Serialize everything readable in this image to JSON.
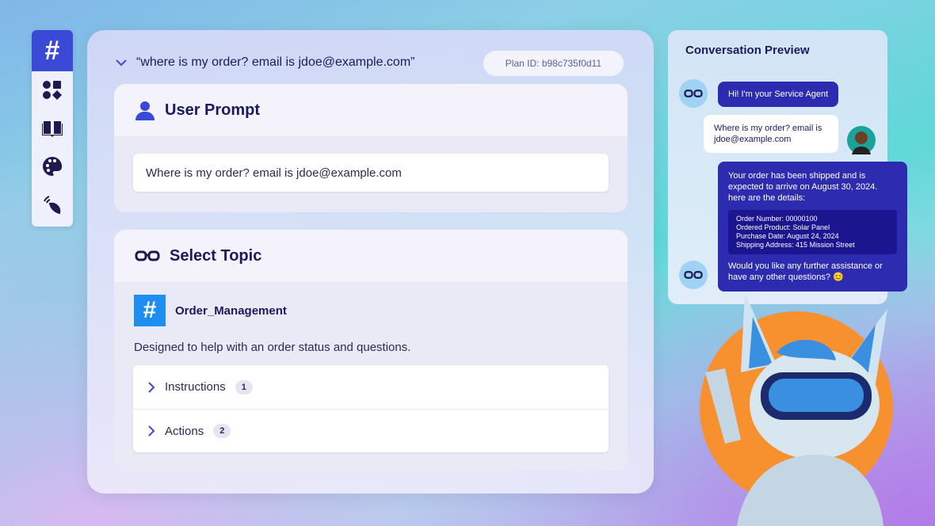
{
  "sidebar": {
    "items": [
      {
        "icon": "hash-icon",
        "active": true,
        "label": "#"
      },
      {
        "icon": "shapes-icon"
      },
      {
        "icon": "book-icon"
      },
      {
        "icon": "palette-icon"
      },
      {
        "icon": "signal-icon"
      }
    ]
  },
  "main": {
    "query": "“where is my order? email is jdoe@example.com”",
    "plan_id": "Plan ID: b98c735f0d11",
    "user_prompt": {
      "title": "User Prompt",
      "value": "Where is my order? email is jdoe@example.com"
    },
    "select_topic": {
      "title": "Select Topic",
      "hash": "#",
      "topic_name": "Order_Management",
      "description": "Designed to help with an order status and questions.",
      "sections": [
        {
          "label": "Instructions",
          "count": "1"
        },
        {
          "label": "Actions",
          "count": "2"
        }
      ]
    }
  },
  "conversation": {
    "title": "Conversation Preview",
    "messages": [
      {
        "role": "agent",
        "text": "Hi! I'm your Service Agent"
      },
      {
        "role": "user",
        "text": "Where is my order? email is jdoe@example.com"
      },
      {
        "role": "agent",
        "text": "Your order has been shipped and is expected to arrive on August 30, 2024. here are the details:",
        "details": [
          "Order Number: 00000100",
          "Ordered Product: Solar Panel",
          "Purchase Date: August 24, 2024",
          "Shipping Address: 415 Mission Street"
        ],
        "followup": "Would you like any further assistance or have any other questions? 😊"
      }
    ]
  },
  "colors": {
    "accent": "#3a49d6",
    "agent_bubble": "#2d2bb0",
    "topic_hash": "#1e8ff0",
    "mascot_bg": "#f7902f"
  }
}
